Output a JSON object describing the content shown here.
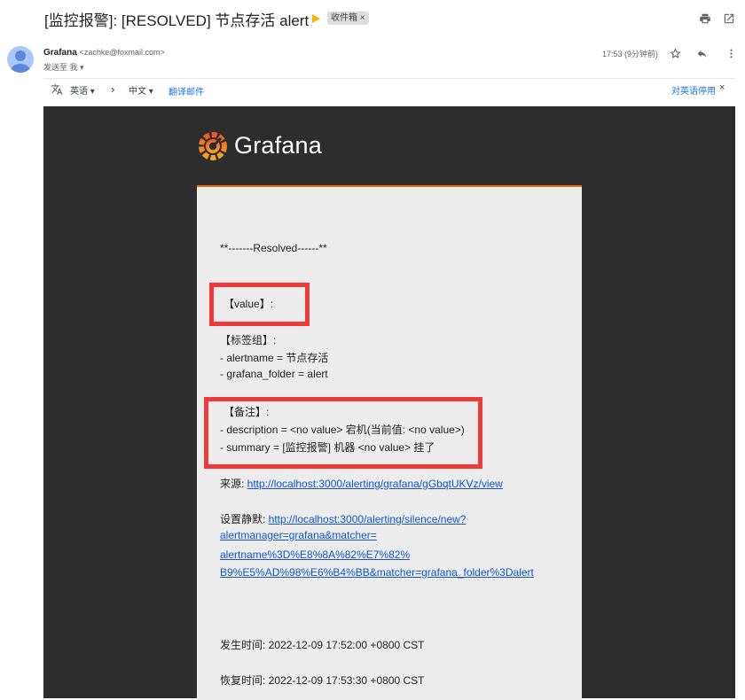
{
  "header": {
    "subject": "[监控报警]: [RESOLVED] 节点存活 alert",
    "label": "收件箱",
    "label_close": "×"
  },
  "sender": {
    "name": "Grafana",
    "email": "<zachke@foxmail.com>",
    "to": "发送至 我",
    "time": "17:53 (9分钟前)"
  },
  "translate": {
    "source_lang": "英语",
    "target_lang": "中文",
    "translate_link": "翻译邮件",
    "disable_link": "对英语停用",
    "close": "×"
  },
  "email": {
    "logo_text": "Grafana",
    "status_line": "**-------Resolved------**",
    "value_line": "【value】:",
    "labels_heading": "【标签组】:",
    "label_alertname": "- alertname = 节点存活",
    "label_folder": "- grafana_folder = alert",
    "notes_heading": "【备注】:",
    "note_description": "- description = <no value> 宕机(当前值: <no value>)",
    "note_summary": "- summary = [监控报警] 机器 <no value> 挂了",
    "source_label": "来源: ",
    "source_url": "http://localhost:3000/alerting/grafana/gGbqtUKVz/view",
    "silence_label": "设置静默: ",
    "silence_url_1": "http://localhost:3000/alerting/silence/new?",
    "silence_url_2": "alertmanager=grafana&matcher=",
    "silence_url_3": "alertname%3D%E8%8A%82%E7%82%",
    "silence_url_4": "B9%E5%AD%98%E6%B4%BB&matcher=grafana_folder%3Dalert",
    "occurred": "发生时间: 2022-12-09 17:52:00 +0800 CST",
    "recovered": "恢复时间: 2022-12-09 17:53:30 +0800 CST"
  },
  "icons": {
    "print": "printer-icon",
    "open_new": "open-in-new-icon",
    "star": "star-icon",
    "reply": "reply-icon",
    "more": "more-vert-icon",
    "translate": "translate-icon"
  },
  "colors": {
    "highlight_box": "#ef3a3a",
    "link": "#1155cc",
    "grafana_orange": "#f46800",
    "email_background": "#2d2d2d",
    "card_background": "#ececec"
  }
}
